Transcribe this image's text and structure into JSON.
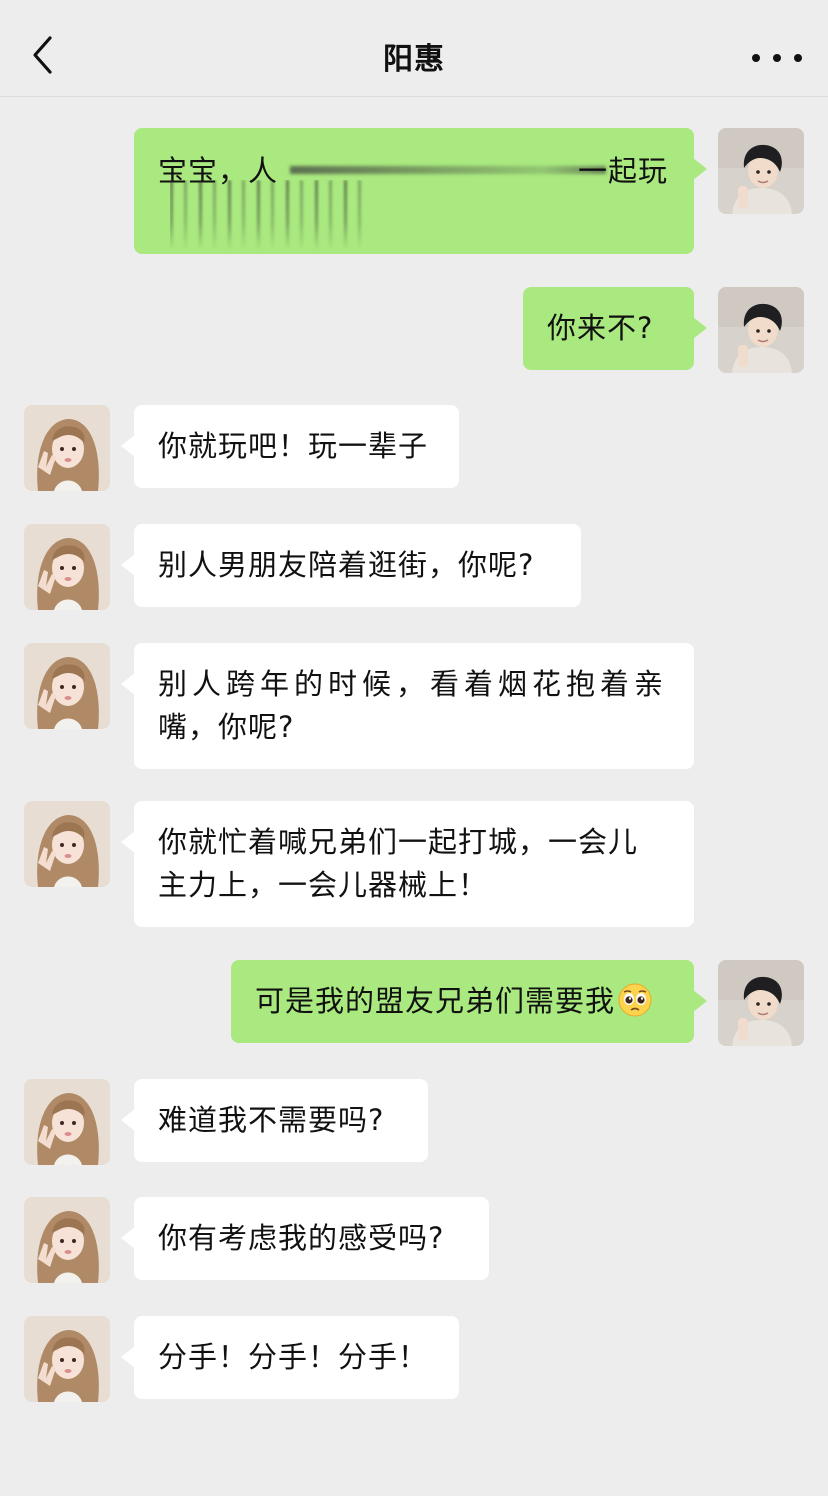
{
  "header": {
    "title": "阳惠",
    "back_icon": "chevron-left-icon",
    "more_icon": "more-dots-icon"
  },
  "colors": {
    "background": "#ededed",
    "sent_bubble": "#a9e97f",
    "received_bubble": "#ffffff"
  },
  "messages": [
    {
      "sender": "me",
      "head": "宝宝，人",
      "tail": "一起玩",
      "blurred": true
    },
    {
      "sender": "me",
      "text": "你来不?"
    },
    {
      "sender": "her",
      "text": "你就玩吧！玩一辈子"
    },
    {
      "sender": "her",
      "text": "别人男朋友陪着逛街，你呢?"
    },
    {
      "sender": "her",
      "line1": "别人跨年的时候，看着烟花抱着亲",
      "line2": "嘴，你呢?"
    },
    {
      "sender": "her",
      "line1": "你就忙着喊兄弟们一起打城，一会儿",
      "line2": "主力上，一会儿器械上！"
    },
    {
      "sender": "me",
      "text": "可是我的盟友兄弟们需要我",
      "emoji": "pleading-face-icon"
    },
    {
      "sender": "her",
      "text": "难道我不需要吗?"
    },
    {
      "sender": "her",
      "text": "你有考虑我的感受吗?"
    },
    {
      "sender": "her",
      "text": "分手！分手！分手！"
    }
  ]
}
